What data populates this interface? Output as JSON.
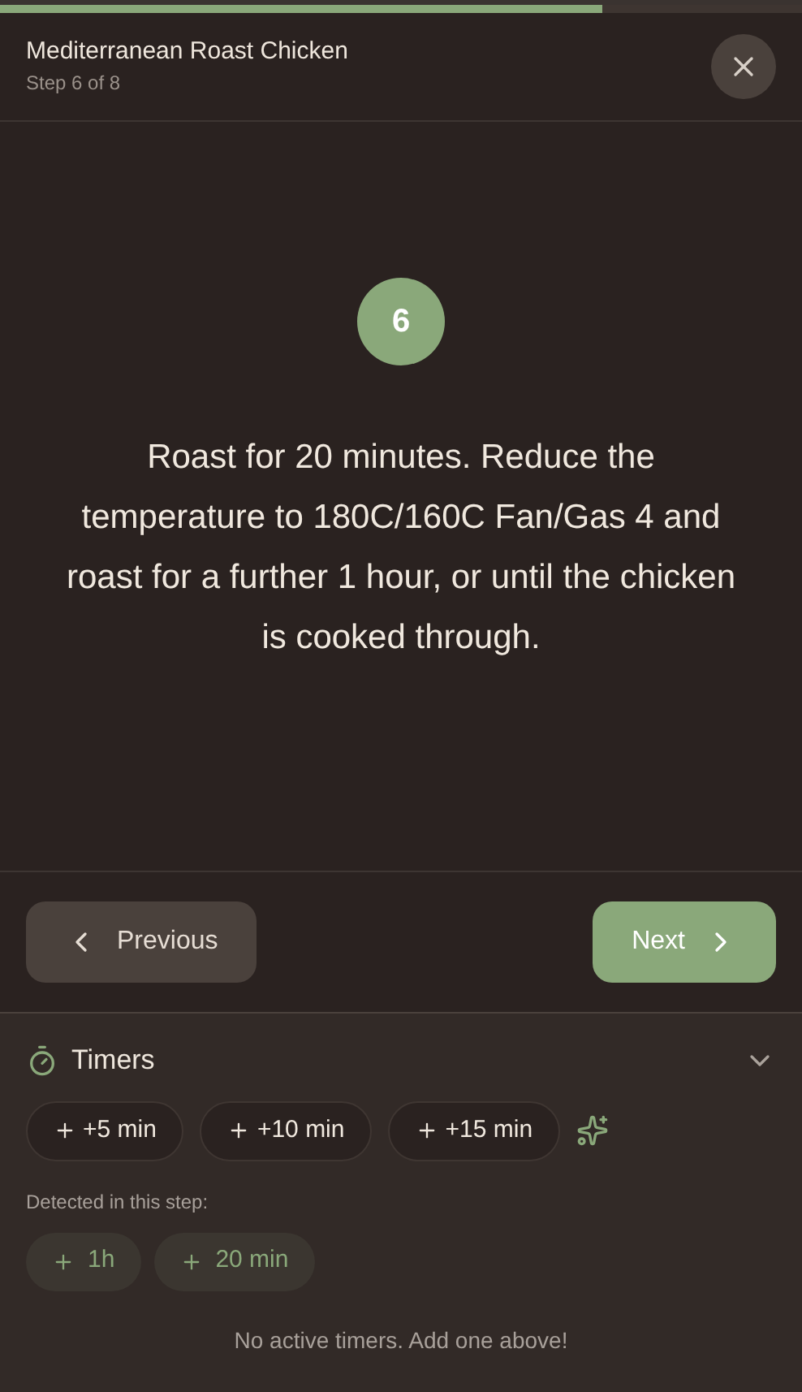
{
  "progress": {
    "level": 0.75
  },
  "header": {
    "title": "Mediterranean Roast Chicken",
    "subtitle": "Step 6 of 8"
  },
  "step": {
    "number": "6",
    "text": "Roast for 20 minutes. Reduce the temperature to 180C/160C Fan/Gas 4 and roast for a further 1 hour, or until the chicken is cooked through."
  },
  "navigation": {
    "previous": "Previous",
    "next": "Next"
  },
  "timers": {
    "title": "Timers",
    "expanded": true,
    "presets": [
      "+5 min",
      "+10 min",
      "+15 min"
    ],
    "detected_label": "Detected in this step:",
    "detected": [
      "1h",
      "20 min"
    ],
    "empty_message": "No active timers. Add one above!"
  }
}
